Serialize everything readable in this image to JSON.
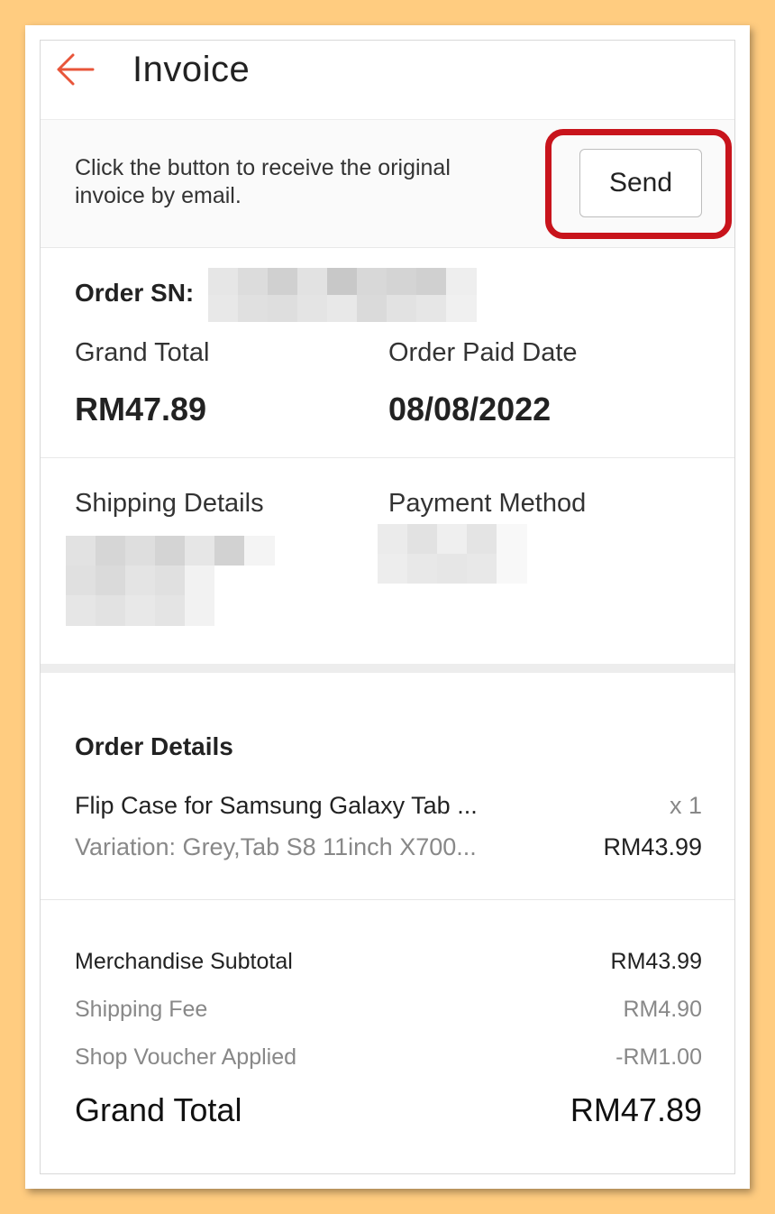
{
  "appbar": {
    "title": "Invoice",
    "back_icon": "arrow-left-icon",
    "accent": "#E8553A"
  },
  "email_banner": {
    "text": "Click the button to receive the original invoice by email.",
    "send_label": "Send",
    "highlight_color": "#C8141C"
  },
  "order_info": {
    "order_sn_label": "Order SN:",
    "grand_total_label": "Grand Total",
    "grand_total_value": "RM47.89",
    "paid_date_label": "Order Paid Date",
    "paid_date_value": "08/08/2022"
  },
  "shipping_payment": {
    "shipping_label": "Shipping Details",
    "payment_label": "Payment Method"
  },
  "order_details": {
    "title": "Order Details",
    "item": {
      "name": "Flip Case for Samsung Galaxy Tab ...",
      "variation": "Variation: Grey,Tab S8 11inch X700...",
      "quantity": "x 1",
      "price": "RM43.99"
    }
  },
  "summary": {
    "merch_label": "Merchandise Subtotal",
    "merch_value": "RM43.99",
    "shipping_label": "Shipping Fee",
    "shipping_value": "RM4.90",
    "voucher_label": "Shop Voucher Applied",
    "voucher_value": "-RM1.00",
    "grand_label": "Grand Total",
    "grand_value": "RM47.89"
  }
}
